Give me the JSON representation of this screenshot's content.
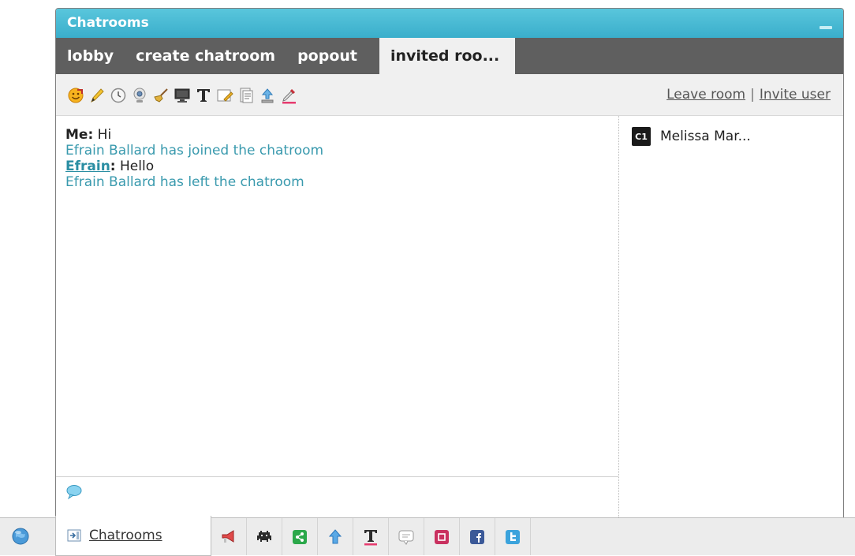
{
  "window": {
    "title": "Chatrooms"
  },
  "tabs": [
    {
      "label": "lobby"
    },
    {
      "label": "create chatroom"
    },
    {
      "label": "popout"
    },
    {
      "label": "invited roo..."
    }
  ],
  "toolbar": {
    "tools": [
      "smiley-icon",
      "pencil-icon",
      "clock-icon",
      "webcam-icon",
      "broom-icon",
      "screenshare-icon",
      "text-format-icon",
      "whiteboard-icon",
      "document-icon",
      "upload-icon",
      "color-picker-icon"
    ],
    "leave_label": "Leave room",
    "separator": "|",
    "invite_label": "Invite user"
  },
  "messages": {
    "m1_sender": "Me:",
    "m1_text": "Hi",
    "m2_text": "Efrain Ballard has joined the chatroom",
    "m3_sender": "Efrain",
    "m3_colon": ":",
    "m3_text": "Hello",
    "m4_text": "Efrain Ballard has left the chatroom"
  },
  "users": [
    {
      "badge": "C1",
      "name": "Melissa Mar..."
    }
  ],
  "bottombar": {
    "active_label": "Chatrooms",
    "icons": [
      "announcement-icon",
      "games-icon",
      "share-icon",
      "upload-icon",
      "text-icon",
      "chat-bubble-icon",
      "pinterest-icon",
      "facebook-icon",
      "twitter-icon"
    ]
  },
  "colors": {
    "titlebar": "#3aaecb",
    "tabbar": "#5f5f5f",
    "system_text": "#3a9aae"
  }
}
